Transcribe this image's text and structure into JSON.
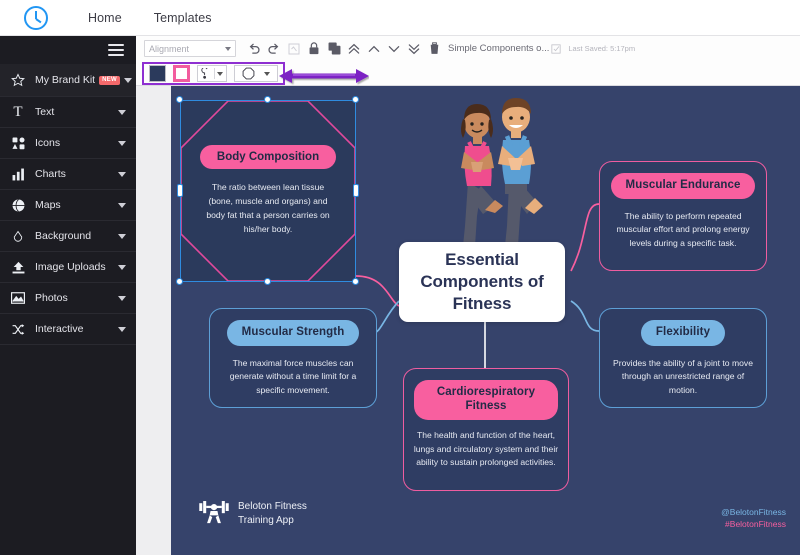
{
  "app": {
    "logo_name": "visme-logo",
    "nav": [
      {
        "label": "Home",
        "name": "nav-home"
      },
      {
        "label": "Templates",
        "name": "nav-templates"
      }
    ]
  },
  "sidebar": {
    "menu_icon": "hamburger-icon",
    "items": [
      {
        "label": "My Brand Kit",
        "icon": "star-icon",
        "badge": "NEW"
      },
      {
        "label": "Text",
        "icon": "text-icon",
        "badge": ""
      },
      {
        "label": "Icons",
        "icon": "icons-grid-icon",
        "badge": ""
      },
      {
        "label": "Charts",
        "icon": "bar-chart-icon",
        "badge": ""
      },
      {
        "label": "Maps",
        "icon": "globe-icon",
        "badge": ""
      },
      {
        "label": "Background",
        "icon": "droplet-icon",
        "badge": ""
      },
      {
        "label": "Image Uploads",
        "icon": "upload-icon",
        "badge": ""
      },
      {
        "label": "Photos",
        "icon": "photo-icon",
        "badge": ""
      },
      {
        "label": "Interactive",
        "icon": "shuffle-icon",
        "badge": ""
      }
    ]
  },
  "toolbar": {
    "alignment_placeholder": "Alignment",
    "undo_icon": "undo-icon",
    "redo_icon": "redo-icon",
    "crop_icon": "crop-icon",
    "lock_icon": "lock-icon",
    "duplicate_icon": "duplicate-icon",
    "bring_front_icon": "bring-to-front-icon",
    "bring_forward_icon": "bring-forward-icon",
    "send_backward_icon": "send-backward-icon",
    "send_back_icon": "send-to-back-icon",
    "delete_icon": "trash-icon",
    "doc_title": "Simple Components o...",
    "rename_icon": "rename-icon",
    "last_saved": "Last Saved: 5:17pm",
    "fill_color": "#2b3a5c",
    "stroke_color": "#f25c9e",
    "fill_swatch_name": "fill-color-swatch",
    "stroke_swatch_name": "stroke-color-swatch",
    "brush_tool_name": "brush-tool",
    "shape_tool_name": "shape-picker",
    "highlight_color": "#8e2fd1",
    "annotation_arrow": "purple-double-arrow"
  },
  "canvas": {
    "background": "#36436b",
    "center": {
      "title": "Essential Components of Fitness"
    },
    "illustration": "two-people-yoga-tree-pose",
    "selected_node": {
      "title": "Body Composition",
      "description": "The ratio between lean tissue (bone, muscle and organs) and body fat that a person carries on his/her body.",
      "accent": "#f85f9f",
      "selection_color": "#2f8ce0"
    },
    "nodes": [
      {
        "title": "Muscular Endurance",
        "description": "The ability to perform repeated muscular effort and prolong energy levels during a specific task.",
        "style": "pink"
      },
      {
        "title": "Flexibility",
        "description": "Provides the ability of a joint to move through an unrestricted range of motion.",
        "style": "blue"
      },
      {
        "title": "Muscular Strength",
        "description": "The maximal force muscles can generate without a time limit for a specific movement.",
        "style": "blue"
      },
      {
        "title": "Cardiorespiratory Fitness",
        "description": "The health and function of the heart, lungs and circulatory system and their ability to sustain prolonged activities.",
        "style": "pink"
      }
    ],
    "brand": {
      "icon": "weightlifter-icon",
      "line1": "Beloton Fitness",
      "line2": "Training App"
    },
    "social": {
      "handle": "@BelotonFitness",
      "hashtag": "#BelotonFitness"
    }
  }
}
